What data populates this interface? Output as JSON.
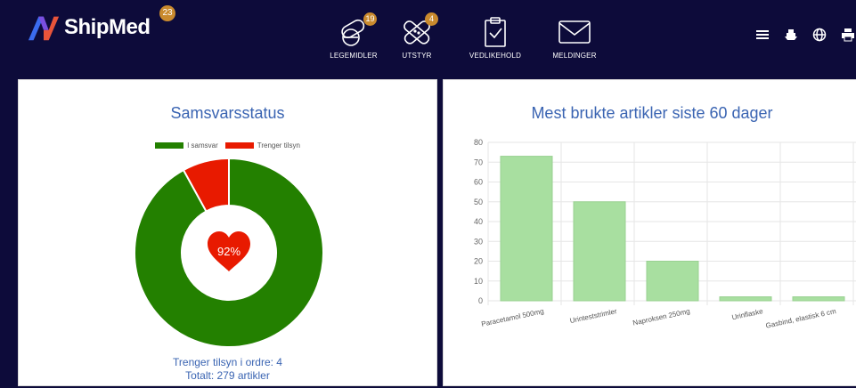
{
  "header": {
    "brand": "ShipMed",
    "brand_badge": "23",
    "nav": [
      {
        "label": "LEGEMIDLER",
        "badge": "19",
        "icon": "pills-icon"
      },
      {
        "label": "UTSTYR",
        "badge": "4",
        "icon": "bandage-icon"
      },
      {
        "label": "VEDLIKEHOLD",
        "badge": "",
        "icon": "clipboard-check-icon"
      },
      {
        "label": "MELDINGER",
        "badge": "",
        "icon": "envelope-icon"
      }
    ],
    "tools": [
      "menu-icon",
      "ship-icon",
      "globe-icon",
      "printer-icon"
    ]
  },
  "compliance": {
    "title": "Samsvarsstatus",
    "center_label": "92%",
    "footer_line1": "Trenger tilsyn i ordre: 4",
    "footer_line2": "Totalt: 279 artikler",
    "colors": {
      "ok": "#238000",
      "attention": "#e81a00",
      "heart": "#e81a00"
    }
  },
  "usage": {
    "title": "Mest brukte artikler siste 60 dager",
    "bar_color": "#a8dfa0"
  },
  "chart_data": [
    {
      "type": "pie",
      "title": "Samsvarsstatus",
      "categories": [
        "I samsvar",
        "Trenger tilsyn"
      ],
      "values": [
        92,
        8
      ],
      "legend_position": "top"
    },
    {
      "type": "bar",
      "title": "Mest brukte artikler siste 60 dager",
      "categories": [
        "Paracetamol 500mg",
        "Urinteststrimler",
        "Naproksen 250mg",
        "Urinflaske",
        "Gasbind, elastisk 6 cm"
      ],
      "values": [
        73,
        50,
        20,
        2,
        2
      ],
      "ylim": [
        0,
        80
      ],
      "yticks": [
        0,
        10,
        20,
        30,
        40,
        50,
        60,
        70,
        80
      ],
      "grid": true
    }
  ]
}
